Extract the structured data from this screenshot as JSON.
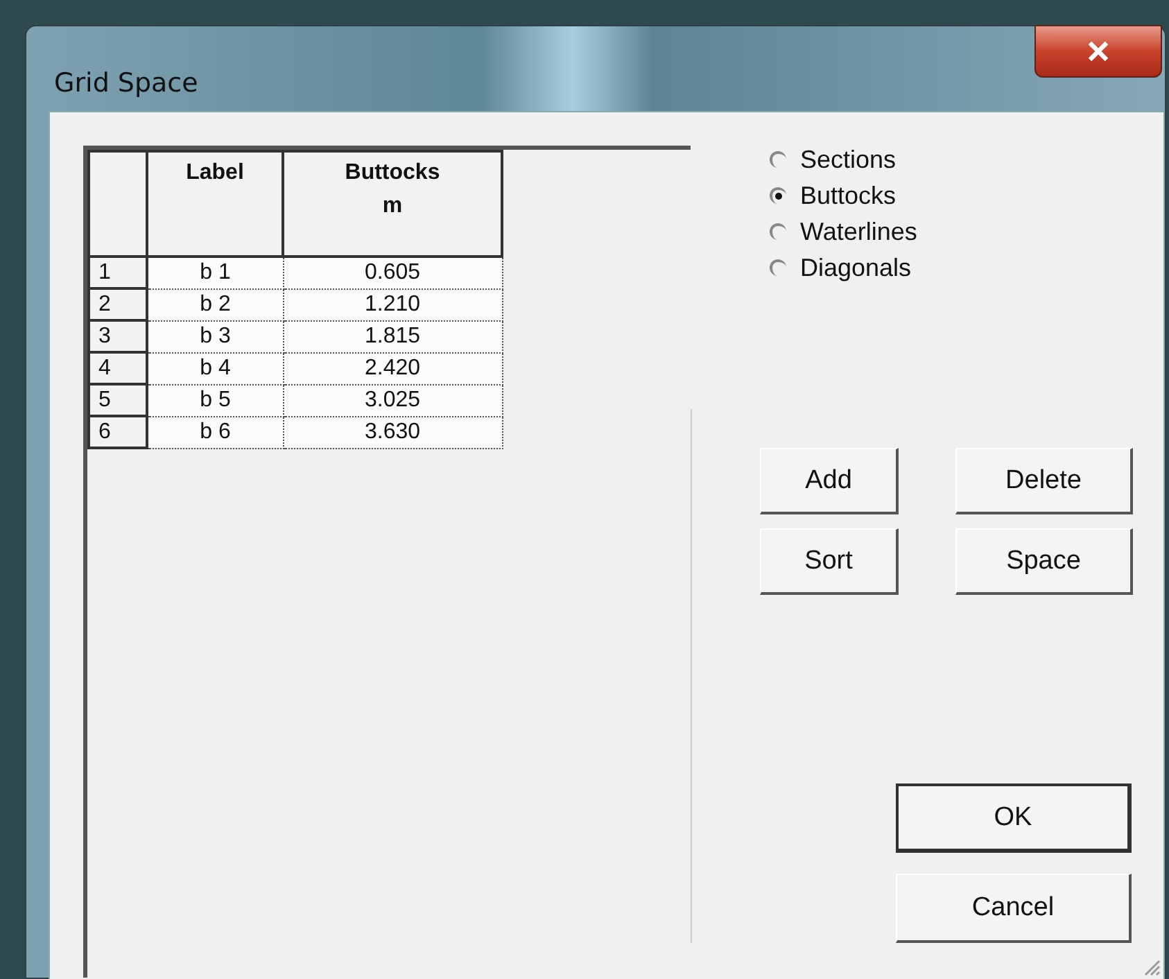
{
  "window": {
    "title": "Grid Space"
  },
  "table": {
    "columns": [
      {},
      {
        "label": "Label"
      },
      {
        "label": "Buttocks\nm"
      }
    ],
    "rows": [
      {
        "number": "1",
        "label": "b 1",
        "value": "0.605"
      },
      {
        "number": "2",
        "label": "b 2",
        "value": "1.210"
      },
      {
        "number": "3",
        "label": "b 3",
        "value": "1.815"
      },
      {
        "number": "4",
        "label": "b 4",
        "value": "2.420"
      },
      {
        "number": "5",
        "label": "b 5",
        "value": "3.025"
      },
      {
        "number": "6",
        "label": "b 6",
        "value": "3.630"
      }
    ]
  },
  "options": [
    {
      "label": "Sections",
      "selected": false
    },
    {
      "label": "Buttocks",
      "selected": true
    },
    {
      "label": "Waterlines",
      "selected": false
    },
    {
      "label": "Diagonals",
      "selected": false
    }
  ],
  "actions": [
    "Add",
    "Delete",
    "Sort",
    "Space"
  ],
  "dialog_buttons": [
    {
      "label": "OK",
      "default": true
    },
    {
      "label": "Cancel",
      "default": false
    }
  ]
}
